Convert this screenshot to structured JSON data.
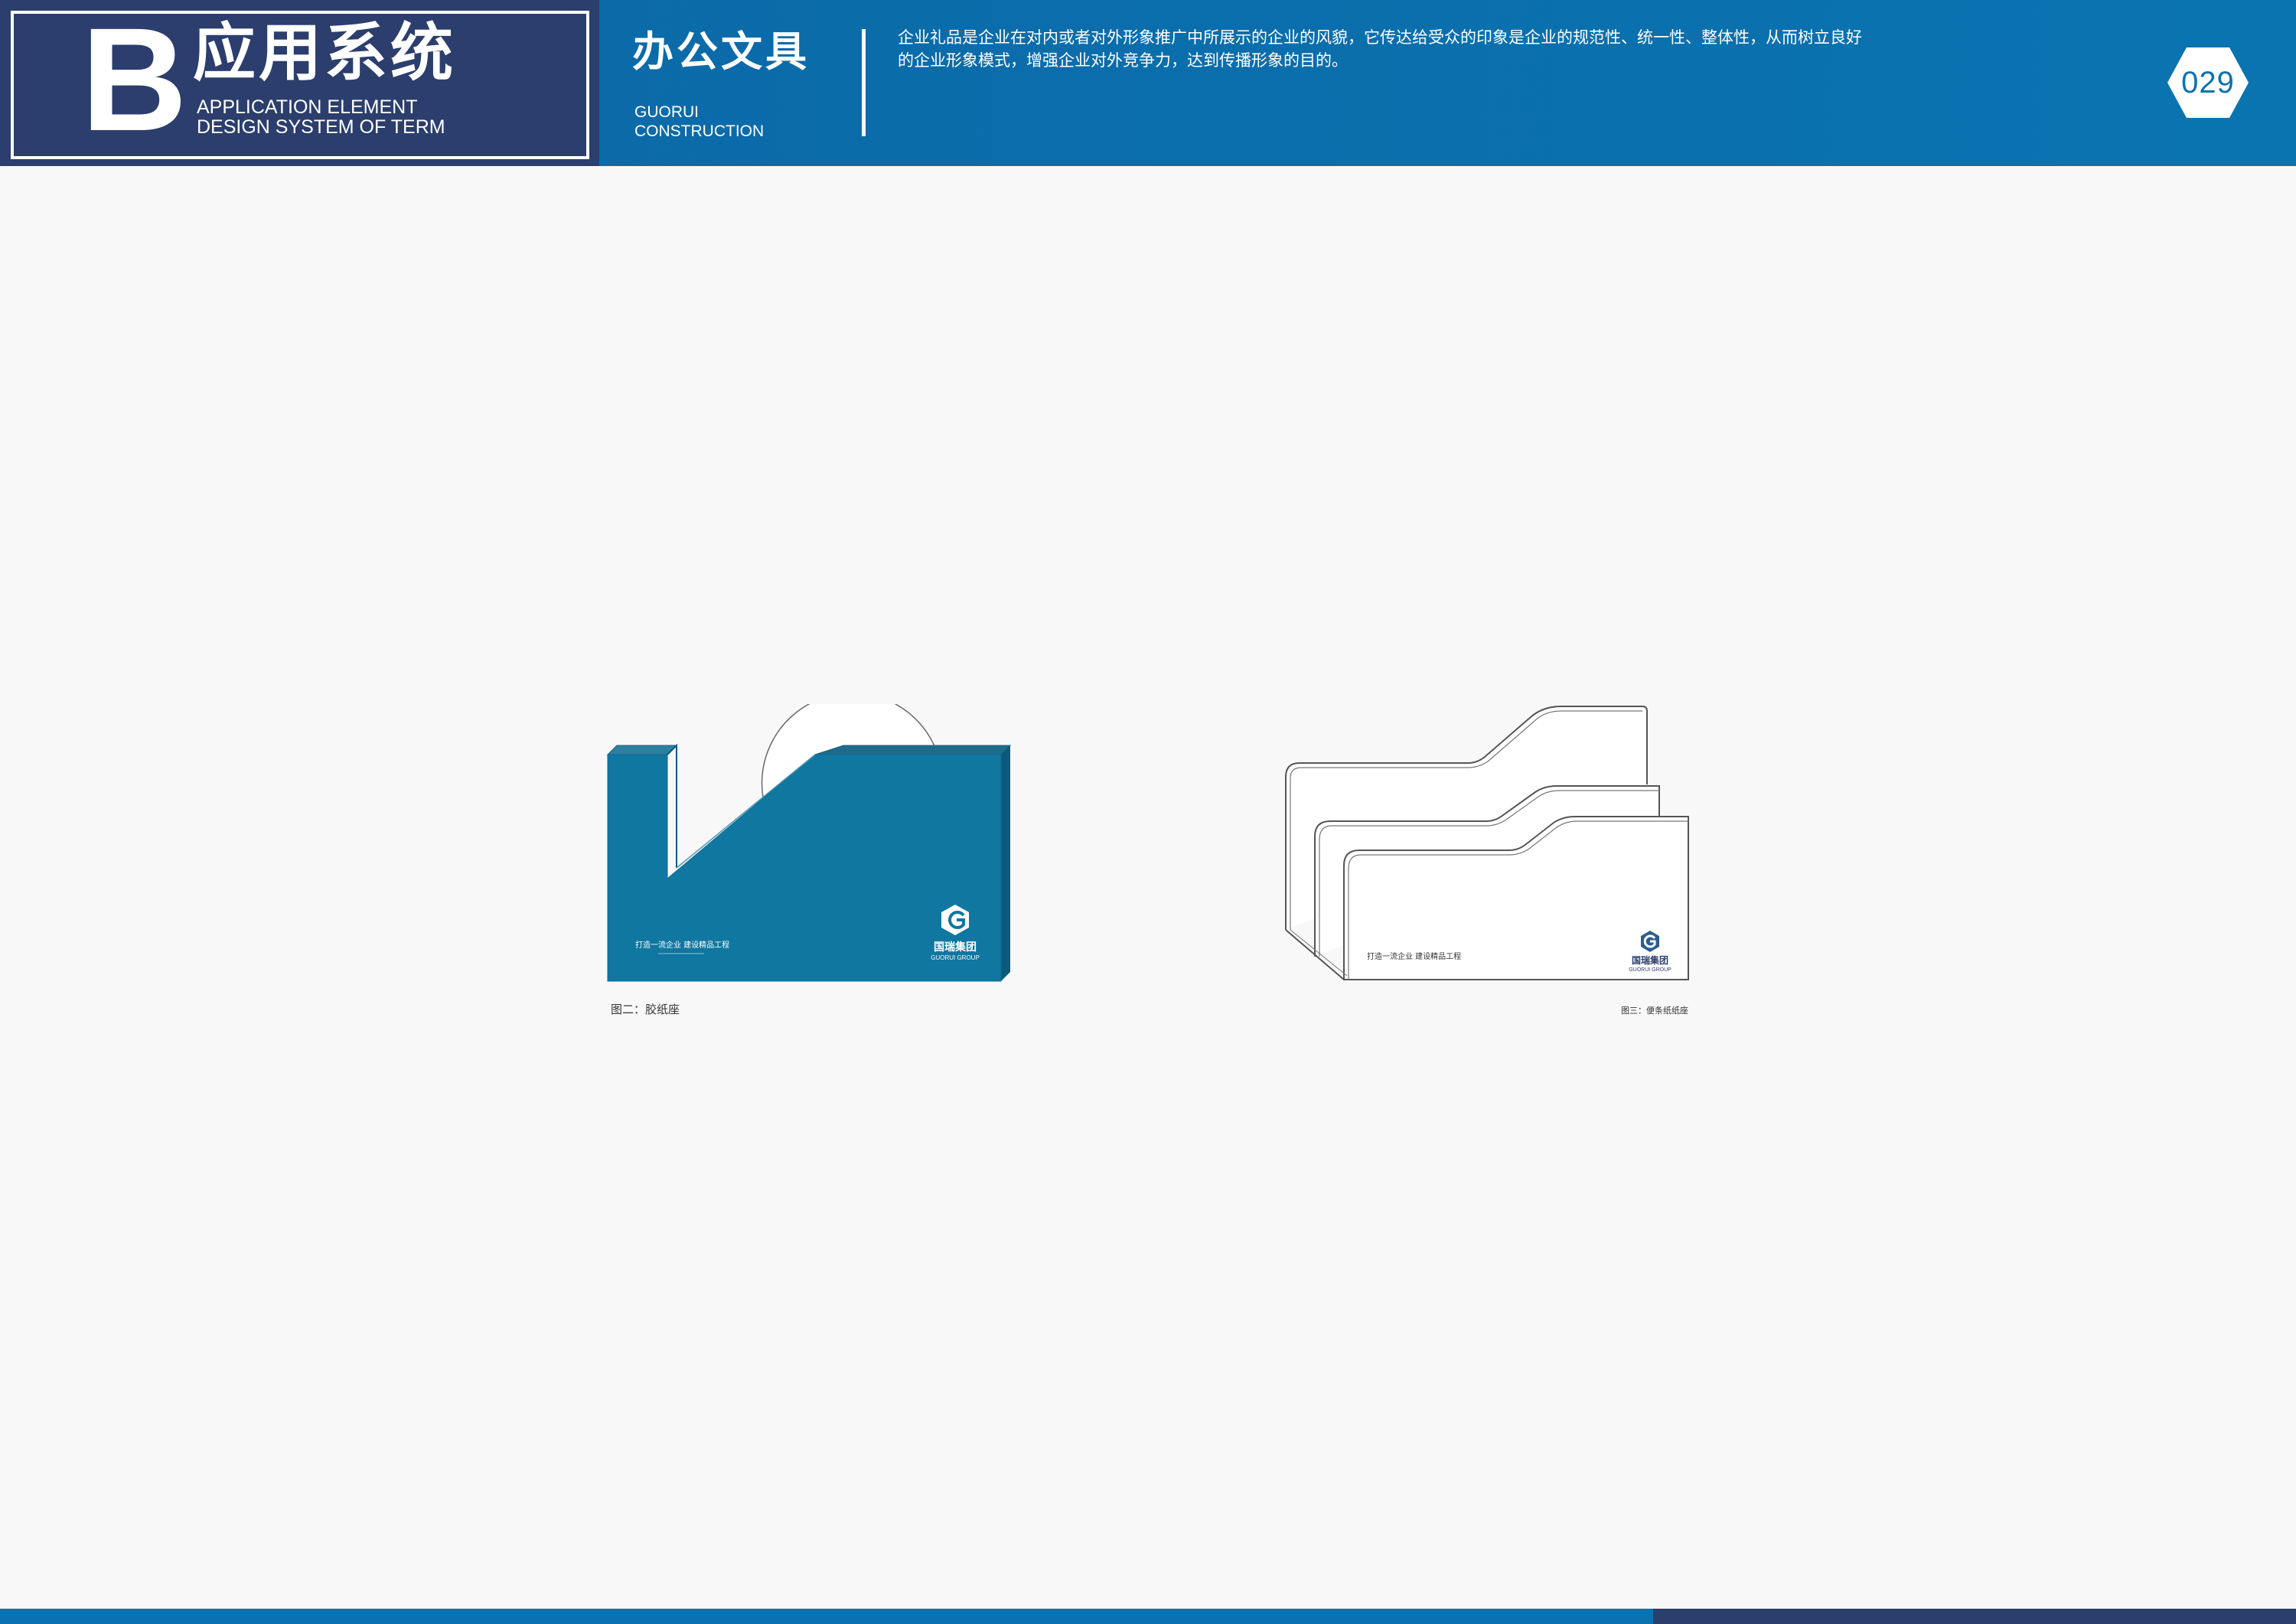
{
  "header": {
    "brand_letter": "B",
    "brand_title": "应用系统",
    "brand_subtitle": "APPLICATION ELEMENT\nDESIGN SYSTEM OF TERM",
    "section_title": "办公文具",
    "section_subtitle_1": "GUORUI",
    "section_subtitle_2": "CONSTRUCTION",
    "intro_text": "企业礼品是企业在对内或者对外形象推广中所展示的企业的风貌，它传达给受众的印象是企业的规范性、统一性、整体性，从而树立良好的企业形象模式，增强企业对外竞争力，达到传播形象的目的。",
    "page_number": "029"
  },
  "products": {
    "tape_dispenser": {
      "slogan": "打造一流企业  建设精品工程",
      "logo_cn": "国瑞集团",
      "logo_en": "GUORUI GROUP",
      "caption": "图二：胶纸座"
    },
    "file_holder": {
      "slogan": "打造一流企业  建设精品工程",
      "logo_cn": "国瑞集团",
      "logo_en": "GUORUI GROUP",
      "caption": "图三：便条纸纸座"
    }
  },
  "colors": {
    "brand_navy": "#2b3e6d",
    "brand_blue": "#0a72b0",
    "product_blue": "#0f77a0"
  }
}
